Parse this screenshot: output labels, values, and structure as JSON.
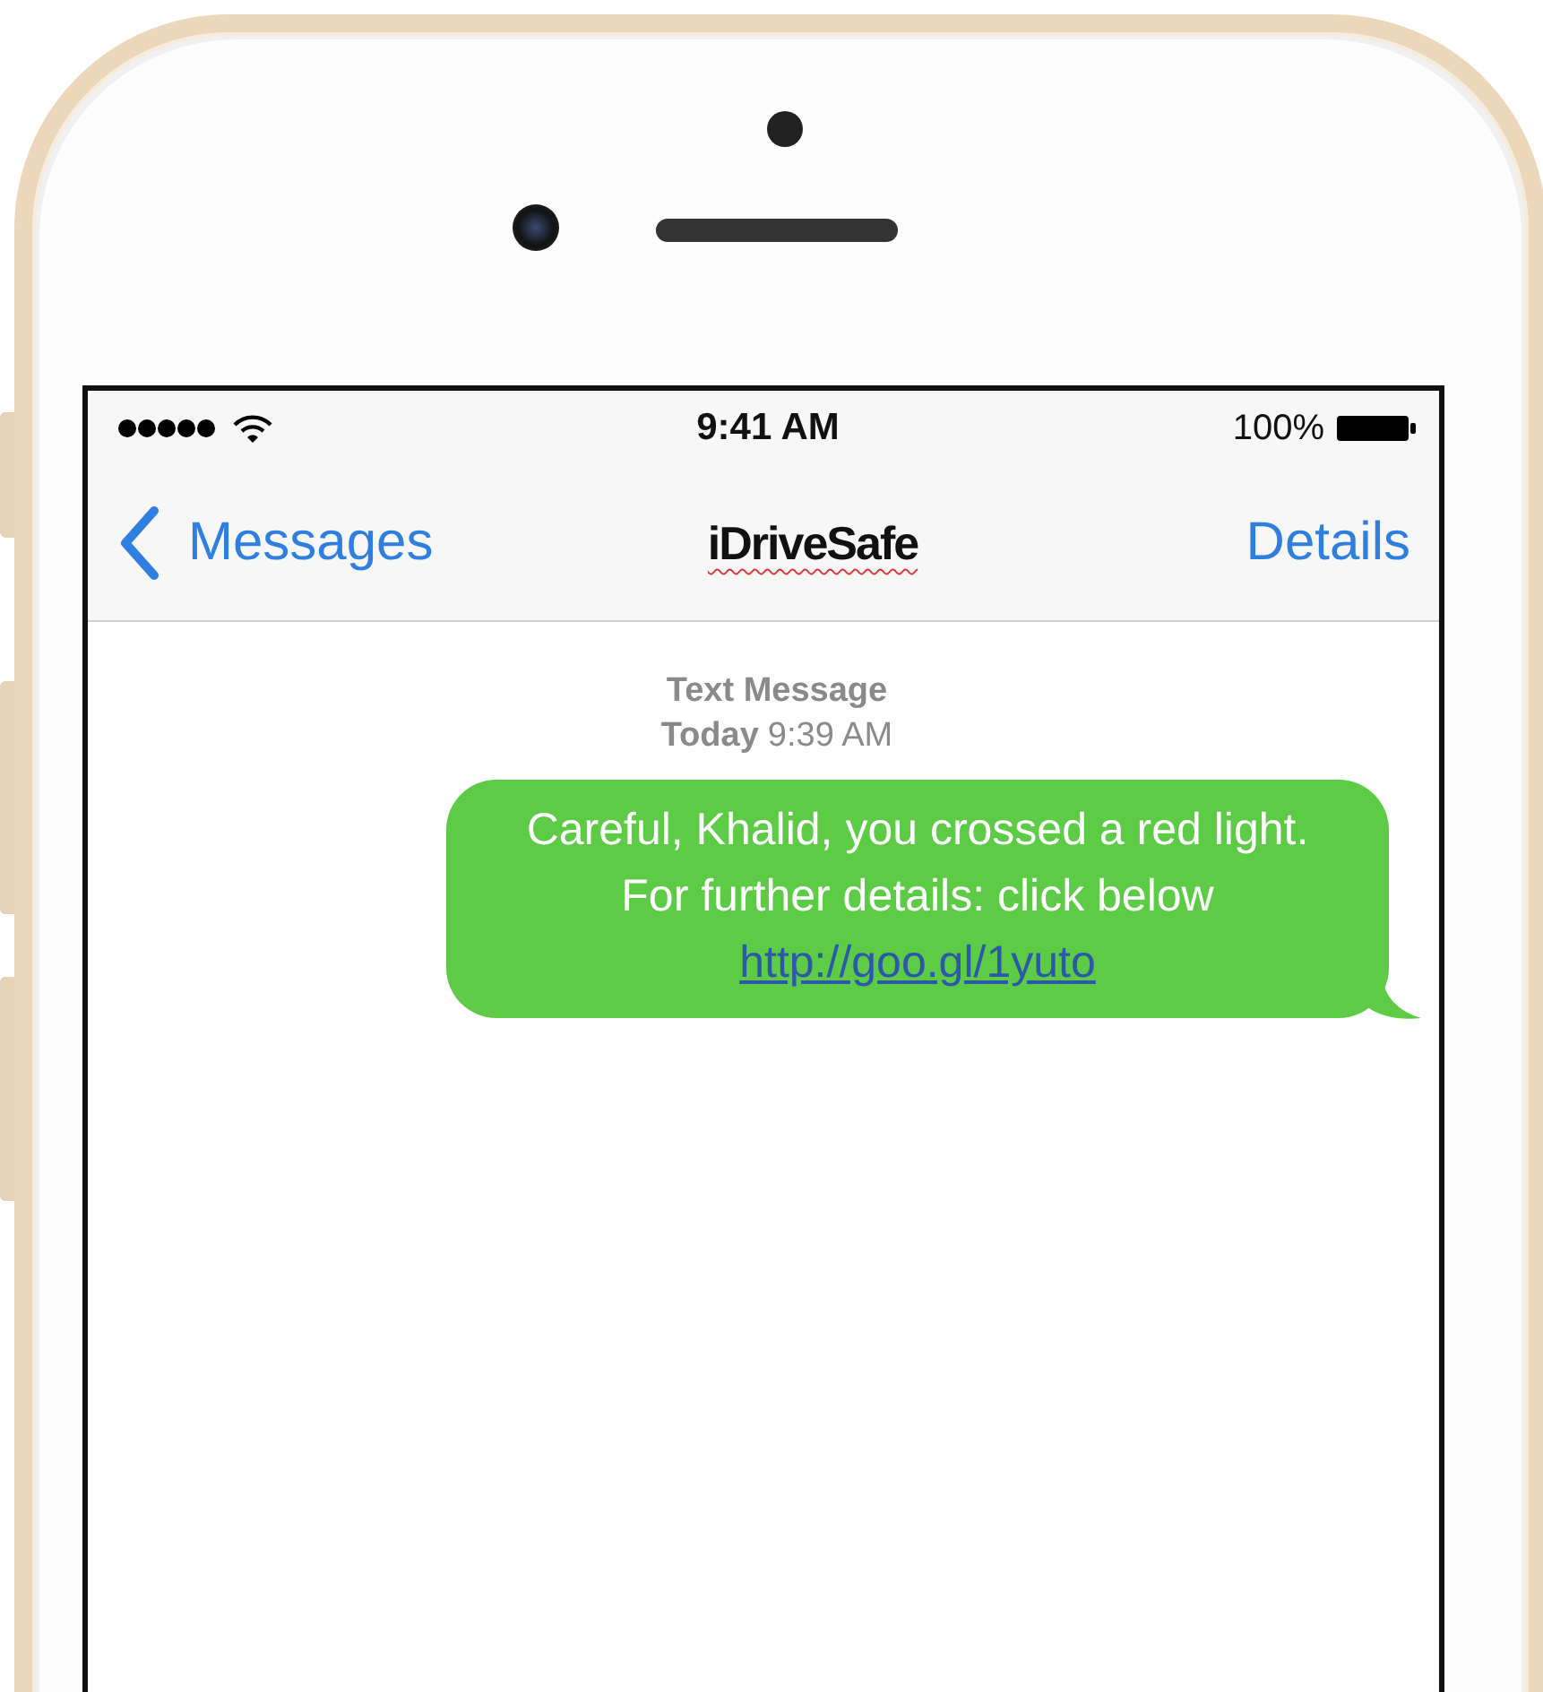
{
  "status_bar": {
    "time": "9:41 AM",
    "battery": "100%"
  },
  "nav_bar": {
    "back": "Messages",
    "title": "iDriveSafe",
    "action": "Details"
  },
  "thread_header": {
    "label": "Text Message",
    "day": "Today",
    "time": "9:39 AM"
  },
  "messages": [
    {
      "kind": "outgoing",
      "lines": [
        "Careful, Khalid, you crossed a red light.",
        "For further details: click below"
      ],
      "link": "http://goo.gl/1yuto"
    }
  ]
}
